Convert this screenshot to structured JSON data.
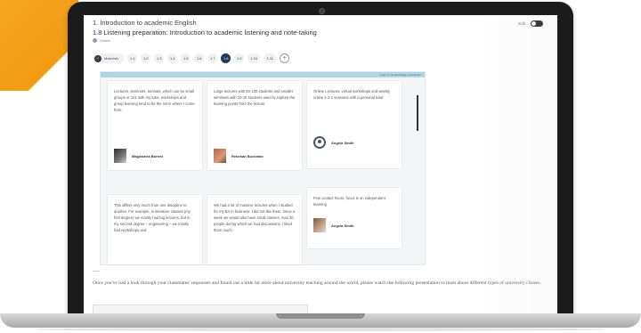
{
  "header": {
    "course_title": "1. Introduction to academic English",
    "step_title": "1.8 Listening preparation: Introduction to academic listening and note-taking",
    "status": "Online",
    "edit_label": "Edit"
  },
  "nav": {
    "materials_label": "Materials",
    "steps": [
      "1.1",
      "1.2",
      "1.3",
      "1.4",
      "1.5",
      "1.6",
      "1.7",
      "1.8",
      "1.9",
      "1.10",
      "1.11"
    ],
    "active_step": "1.8"
  },
  "panel": {
    "bar_label": "Learn on Sourcewidge contribution"
  },
  "cards": [
    {
      "text": "Lectures, seminars, tutorials, which can be small groups or 121 with my tutor, workshops and group learning tend to be the norm where I come from.",
      "author": "Magdalena Barrett"
    },
    {
      "text": "Large lectures with 50-100 students and smaller seminars with 10-15 students used to explore the learning points from the lecture",
      "author": "Rebekah Buckman"
    },
    {
      "text": "Online Lectures, virtual workshops and weekly online 1-2-1 sessions with a personal tutor",
      "author": "Angela Smith"
    },
    {
      "text": "This differs very much from one discipline to another. For example, in literature classes (my first degree) we mostly had big lectures, but in my second degree – engineering – we mostly had workshops and",
      "author": ""
    },
    {
      "text": "We had a lot of massive lectures when I studied for my BA in business. I did not like them. Once a week we would also have small classes, max 20 people during which we had discussions. I liked them much",
      "author": ""
    },
    {
      "text": "Few contact hours, focus is on independent learning",
      "author": "Angela Smith"
    }
  ],
  "body_text": "Once you've had a look through your classmates' responses and found out a little bit more about university teaching around the world, please watch the following presentation to learn about different types of university classes."
}
